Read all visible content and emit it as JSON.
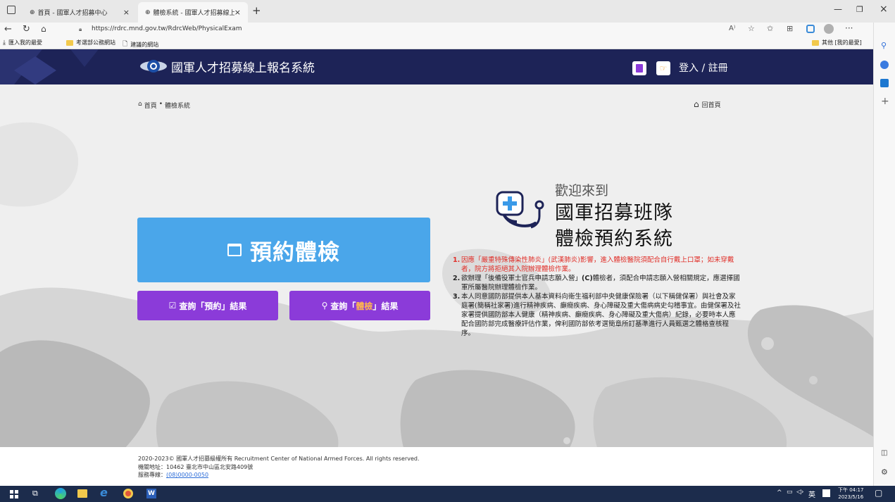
{
  "browser": {
    "tabs": [
      {
        "title": "首頁 - 國軍人才招募中心"
      },
      {
        "title": "體檢系統 - 國軍人才招募線上報名"
      }
    ],
    "url": "https://rdrc.mnd.gov.tw/RdrcWeb/PhysicalExam",
    "favorites": [
      "匯入我的最愛",
      "考選部公務網站",
      "建議的網站"
    ],
    "other_favorites": "其他 [我的最愛]"
  },
  "site": {
    "title": "國軍人才招募線上報名系統",
    "login": "登入 / 註冊"
  },
  "breadcrumb": {
    "home": "首頁",
    "sep": "•",
    "current": "體檢系統",
    "back": "回首頁"
  },
  "hero": {
    "welcome": "歡迎來到",
    "line1": "國軍招募班隊",
    "line2": "體檢預約系統",
    "book_label": "預約體檢",
    "query_booking": "查詢「預約」結果",
    "query_exam_pre": "查詢「",
    "query_exam_mid": "體檢",
    "query_exam_post": "」結果"
  },
  "notices": [
    {
      "num": "1.",
      "text": "因應「嚴重特殊傳染性肺炎」(武漢肺炎)影響，進入體檢醫院須配合自行戴上口罩；如未穿戴者，院方將拒絕其入院辦理體檢作業。"
    },
    {
      "num": "2.",
      "text_pre": "欲辦理「後備役軍士官兵申請志願入營」",
      "text_bold": "(C)",
      "text_post": "體檢者，須配合申請志願入營相關規定，應選擇國軍所屬醫院辦理體檢作業。"
    },
    {
      "num": "3.",
      "text": "本人同意國防部提供本人基本資料向衛生福利部中央健康保險署（以下稱健保署）與社會及家庭署(簡稱社家署)進行精神疾病、癲癇疾病、身心障礙及重大傷病病史勾稽事宜。由健保署及社家署提供國防部本人健康（精神疾病、癲癇疾病、身心障礙及重大傷病）紀錄，必要時本人應配合國防部完成醫療評估作業，俾利國防部依考選簡章所訂基準進行人員甄選之體格查核程序。"
    }
  ],
  "footer": {
    "copyright": "2020-2023© 國軍人才招募級權所有 Recruitment Center of National Armed Forces. All rights reserved.",
    "address": "機關地址：10462 臺北市中山區北安路409號",
    "phone_label": "服務專線：",
    "phone": "(08)0000-0050"
  },
  "taskbar": {
    "time": "下午 04:17",
    "date": "2023/5/16",
    "ime": "英"
  },
  "colors": {
    "navbar": "#1d2357",
    "book_button": "#4aa6ea",
    "query_button": "#8b3bd9",
    "notice_red": "#e0302a",
    "exam_highlight": "#ffb74d"
  }
}
